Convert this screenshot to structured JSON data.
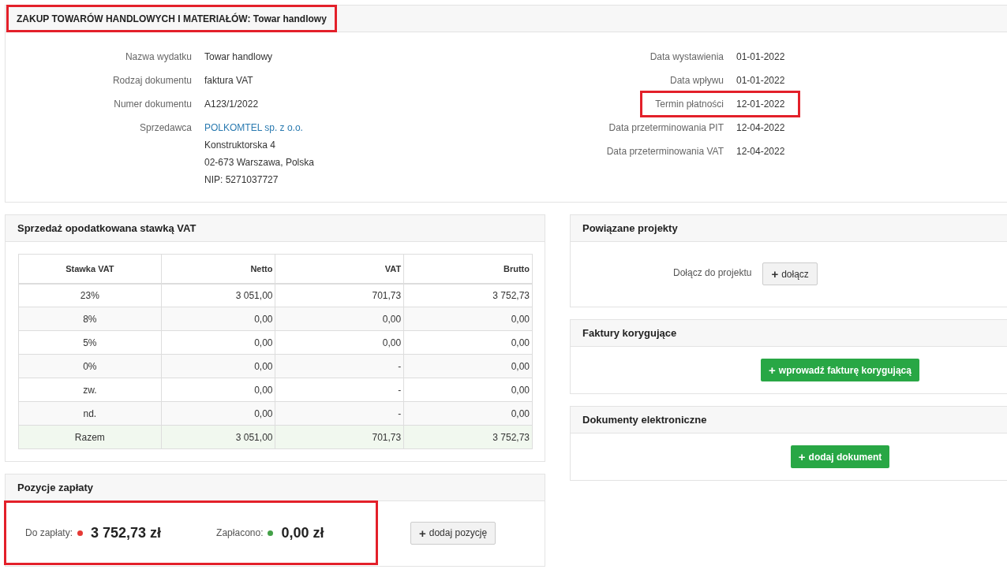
{
  "header": {
    "title": "ZAKUP TOWARÓW HANDLOWYCH I MATERIAŁÓW: Towar handlowy",
    "highlighted": true
  },
  "details_left": [
    {
      "label": "Nazwa wydatku",
      "lines": [
        "Towar handlowy"
      ],
      "kind": "text",
      "highlighted": false
    },
    {
      "label": "Rodzaj dokumentu",
      "lines": [
        "faktura VAT"
      ],
      "kind": "text",
      "highlighted": false
    },
    {
      "label": "Numer dokumentu",
      "lines": [
        "A123/1/2022"
      ],
      "kind": "text",
      "highlighted": false
    },
    {
      "label": "Sprzedawca",
      "lines": [
        "POLKOMTEL sp. z o.o.",
        "Konstruktorska 4",
        "02-673 Warszawa, Polska",
        "NIP: 5271037727"
      ],
      "kind": "link",
      "highlighted": false
    }
  ],
  "details_right": [
    {
      "label": "Data wystawienia",
      "lines": [
        "01-01-2022"
      ],
      "highlighted": false
    },
    {
      "label": "Data wpływu",
      "lines": [
        "01-01-2022"
      ],
      "highlighted": false
    },
    {
      "label": "Termin płatności",
      "lines": [
        "12-01-2022"
      ],
      "highlighted": true
    },
    {
      "label": "Data przeterminowania PIT",
      "lines": [
        "12-04-2022"
      ],
      "highlighted": false
    },
    {
      "label": "Data przeterminowania VAT",
      "lines": [
        "12-04-2022"
      ],
      "highlighted": false
    }
  ],
  "vat_panel": {
    "title": "Sprzedaż opodatkowana stawką VAT",
    "columns": [
      "Stawka VAT",
      "Netto",
      "VAT",
      "Brutto"
    ],
    "rows": [
      [
        "23%",
        "3 051,00",
        "701,73",
        "3 752,73"
      ],
      [
        "8%",
        "0,00",
        "0,00",
        "0,00"
      ],
      [
        "5%",
        "0,00",
        "0,00",
        "0,00"
      ],
      [
        "0%",
        "0,00",
        "-",
        "0,00"
      ],
      [
        "zw.",
        "0,00",
        "-",
        "0,00"
      ],
      [
        "nd.",
        "0,00",
        "-",
        "0,00"
      ]
    ],
    "total": [
      "Razem",
      "3 051,00",
      "701,73",
      "3 752,73"
    ]
  },
  "payments_panel": {
    "title": "Pozycje zapłaty",
    "highlighted": true,
    "items": [
      {
        "label": "Do zapłaty:",
        "amount": "3 752,73 zł",
        "color": "#e53935"
      },
      {
        "label": "Zapłacono:",
        "amount": "0,00 zł",
        "color": "#43a047"
      }
    ],
    "button": {
      "icon": "+",
      "label": "dodaj pozycję"
    }
  },
  "projects_panel": {
    "title": "Powiązane projekty",
    "label": "Dołącz do projektu",
    "button": {
      "icon": "+",
      "label": "dołącz"
    }
  },
  "corrections_panel": {
    "title": "Faktury korygujące",
    "button": {
      "icon": "+",
      "label": "wprowadź fakturę korygującą"
    }
  },
  "documents_panel": {
    "title": "Dokumenty elektroniczne",
    "button": {
      "icon": "+",
      "label": "dodaj dokument"
    }
  }
}
